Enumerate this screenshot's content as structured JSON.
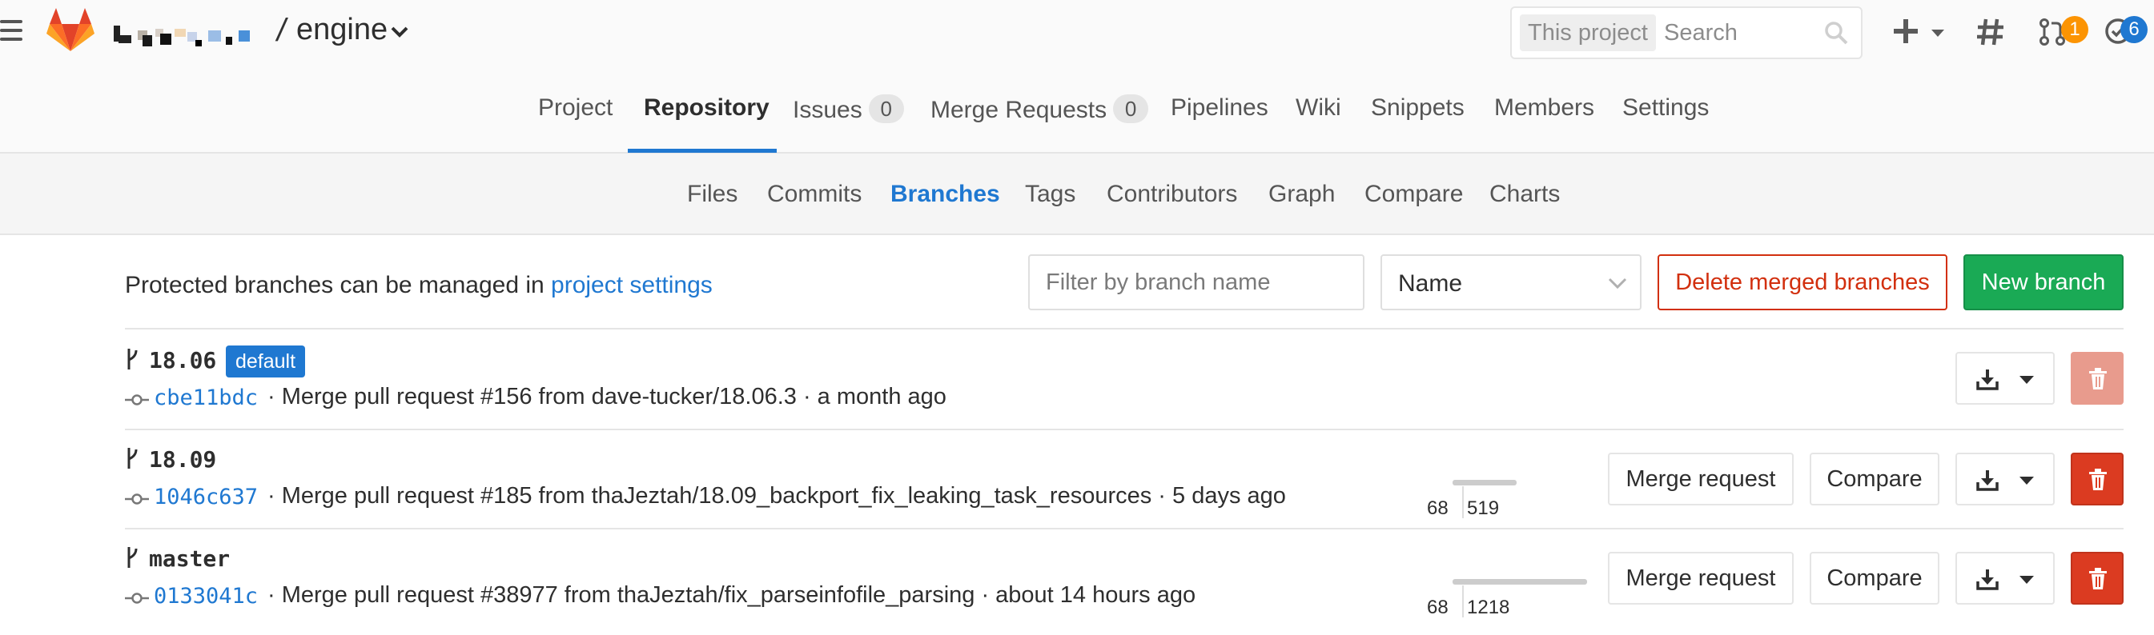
{
  "header": {
    "project_name": "engine",
    "separator": "/",
    "search": {
      "scope": "This project",
      "placeholder": "Search"
    },
    "merge_requests_count": "1",
    "todos_count": "6"
  },
  "main_nav": {
    "items": [
      {
        "label": "Project"
      },
      {
        "label": "Repository"
      },
      {
        "label": "Issues",
        "count": "0"
      },
      {
        "label": "Merge Requests",
        "count": "0"
      },
      {
        "label": "Pipelines"
      },
      {
        "label": "Wiki"
      },
      {
        "label": "Snippets"
      },
      {
        "label": "Members"
      },
      {
        "label": "Settings"
      }
    ],
    "active": "Repository"
  },
  "sub_nav": {
    "items": [
      "Files",
      "Commits",
      "Branches",
      "Tags",
      "Contributors",
      "Graph",
      "Compare",
      "Charts"
    ],
    "active": "Branches"
  },
  "controls": {
    "info_prefix": "Protected branches can be managed in",
    "info_link": "project settings",
    "filter_placeholder": "Filter by branch name",
    "sort_value": "Name",
    "delete_merged_label": "Delete merged branches",
    "new_branch_label": "New branch"
  },
  "branches": [
    {
      "name": "18.06",
      "badge": "default",
      "sha": "cbe11bdc",
      "message": "· Merge pull request #156 from dave-tucker/18.06.3 · a month ago"
    },
    {
      "name": "18.09",
      "sha": "1046c637",
      "message": "· Merge pull request #185 from thaJeztah/18.09_backport_fix_leaking_task_resources · 5 days ago",
      "behind": "68",
      "ahead": "519",
      "merge_request_label": "Merge request",
      "compare_label": "Compare"
    },
    {
      "name": "master",
      "sha": "0133041c",
      "message": "· Merge pull request #38977 from thaJeztah/fix_parseinfofile_parsing · about 14 hours ago",
      "behind": "68",
      "ahead": "1218",
      "merge_request_label": "Merge request",
      "compare_label": "Compare"
    }
  ],
  "colors": {
    "link": "#1f78d1",
    "danger": "#db3b21",
    "success": "#1aaa55",
    "mr_badge": "#fc9403",
    "todo_badge": "#1f78d1"
  },
  "icons": [
    "menu-icon",
    "gitlab-logo",
    "chevron-down-icon",
    "search-icon",
    "plus-icon",
    "hash-icon",
    "merge-request-icon",
    "todo-icon",
    "branch-icon",
    "commit-icon",
    "download-icon",
    "trash-icon"
  ]
}
